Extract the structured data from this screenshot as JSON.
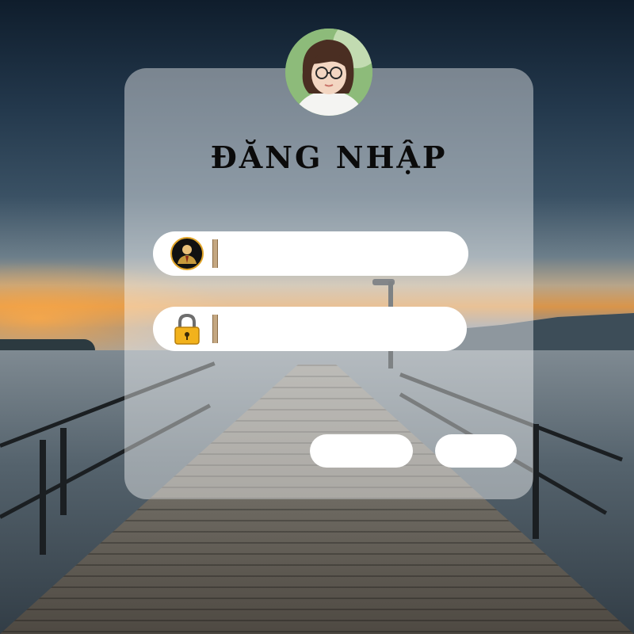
{
  "login": {
    "title": "ĐĂNG NHẬP",
    "username": {
      "value": "",
      "placeholder": "",
      "icon": "user-icon"
    },
    "password": {
      "value": "",
      "placeholder": "",
      "icon": "lock-icon"
    },
    "primary_button_label": "",
    "secondary_button_label": ""
  },
  "colors": {
    "card_background": "rgba(255,255,255,0.42)",
    "field_background": "#ffffff",
    "title_color": "#0b0b0b",
    "lock_gold": "#f2b21c",
    "user_icon_ring": "#e1a52a"
  }
}
